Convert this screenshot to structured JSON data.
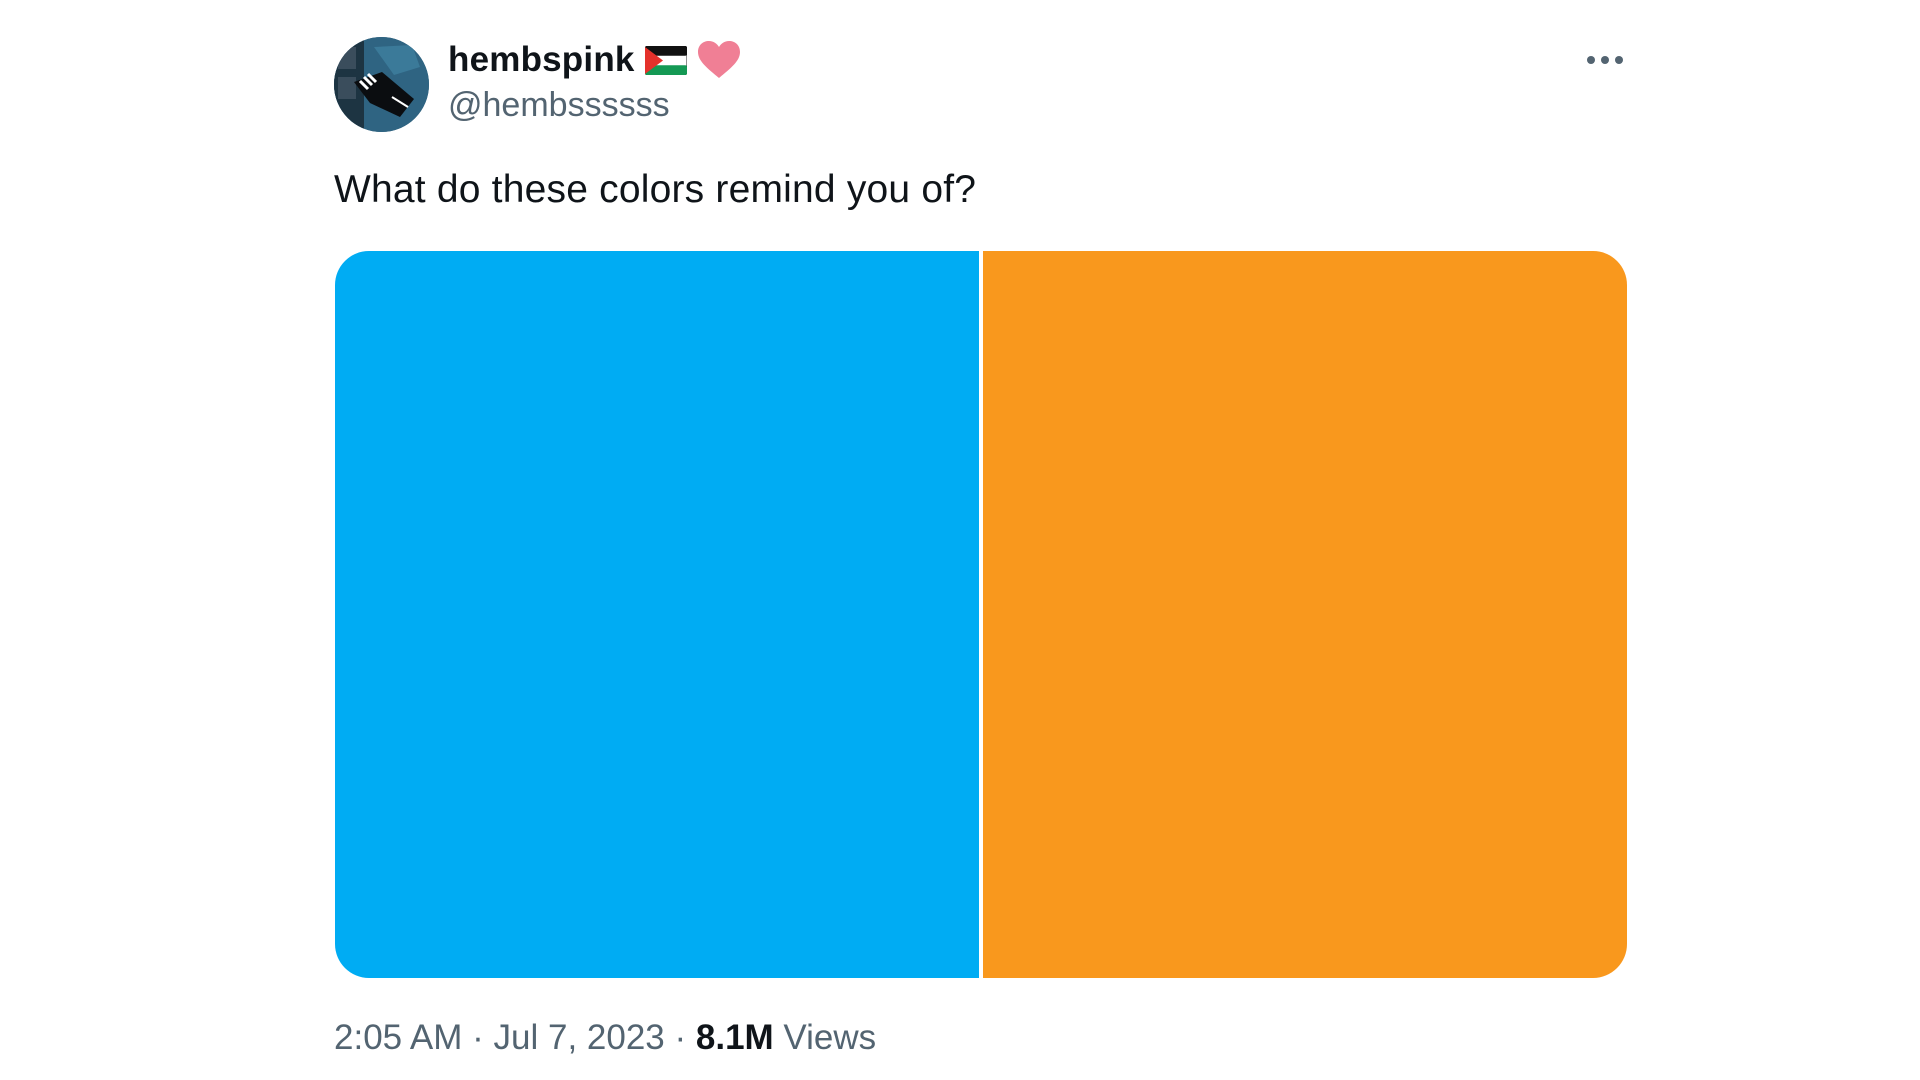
{
  "author": {
    "display_name": "hembspink",
    "handle": "@hembssssss",
    "avatar_icon": "avatar-icon",
    "flag_icon": "palestine-flag-icon",
    "heart_icon": "pink-heart-icon"
  },
  "more_icon": "more-horizontal-icon",
  "tweet": {
    "text": "What do these colors remind you of?"
  },
  "media": {
    "left_color": "#00acf3",
    "right_color": "#f9981d"
  },
  "meta": {
    "time": "2:05 AM",
    "separator": " · ",
    "date": "Jul 7, 2023",
    "views_count": "8.1M",
    "views_label": " Views"
  },
  "colors": {
    "text_primary": "#0f1419",
    "text_secondary": "#536471",
    "heart": "#f07f95",
    "flag_red": "#e4312b",
    "flag_green": "#149954"
  }
}
